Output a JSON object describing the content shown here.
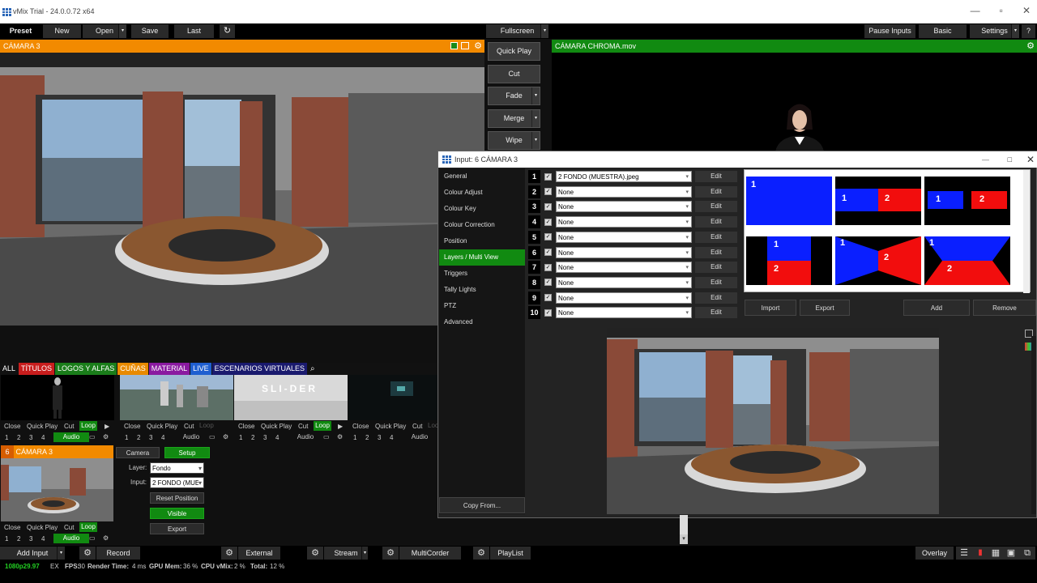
{
  "window": {
    "title": "vMix Trial - 24.0.0.72 x64",
    "controls": [
      "—",
      "▫",
      "✕"
    ]
  },
  "menu": {
    "preset": "Preset",
    "new": "New",
    "open": "Open",
    "save": "Save",
    "last": "Last",
    "fullscreen": "Fullscreen",
    "pause_inputs": "Pause Inputs",
    "basic": "Basic",
    "settings": "Settings",
    "help": "?"
  },
  "preview": {
    "title": "CÁMARA 3"
  },
  "output": {
    "title": "CÁMARA CHROMA.mov"
  },
  "transitions": {
    "quick_play": "Quick Play",
    "cut": "Cut",
    "fade": "Fade",
    "merge": "Merge",
    "wipe": "Wipe"
  },
  "tabs": [
    {
      "label": "ALL",
      "color": "#111111"
    },
    {
      "label": "TÍTULOS",
      "color": "#c81d1d"
    },
    {
      "label": "LOGOS Y ALFAS",
      "color": "#1a7d1a"
    },
    {
      "label": "CUÑAS",
      "color": "#e88a00"
    },
    {
      "label": "MATERIAL",
      "color": "#8a1aa0"
    },
    {
      "label": "LIVE",
      "color": "#1f5fd0"
    },
    {
      "label": "ESCENARIOS VIRTUALES",
      "color": "#1a1a6e"
    }
  ],
  "input_controls": {
    "close": "Close",
    "quick_play": "Quick Play",
    "cut": "Cut",
    "loop": "Loop",
    "audio": "Audio",
    "nums": [
      "1",
      "2",
      "3",
      "4"
    ],
    "loc": "Loc"
  },
  "slider_text": "SLI-DER",
  "input6": {
    "number": "6",
    "title": "CÁMARA 3",
    "camera": "Camera",
    "setup": "Setup",
    "layer_label": "Layer:",
    "layer_value": "Fondo",
    "input_label": "Input:",
    "input_value": "2 FONDO (MUE",
    "reset": "Reset Position",
    "visible": "Visible",
    "export": "Export"
  },
  "dialog": {
    "title": "Input: 6 CÁMARA 3",
    "nav": [
      "General",
      "Colour Adjust",
      "Colour Key",
      "Colour Correction",
      "Position",
      "Layers / Multi View",
      "Triggers",
      "Tally Lights",
      "PTZ",
      "Advanced"
    ],
    "copy_from": "Copy From...",
    "edit": "Edit",
    "layers": [
      {
        "n": "1",
        "value": "2 FONDO (MUESTRA).jpeg"
      },
      {
        "n": "2",
        "value": "None"
      },
      {
        "n": "3",
        "value": "None"
      },
      {
        "n": "4",
        "value": "None"
      },
      {
        "n": "5",
        "value": "None"
      },
      {
        "n": "6",
        "value": "None"
      },
      {
        "n": "7",
        "value": "None"
      },
      {
        "n": "8",
        "value": "None"
      },
      {
        "n": "9",
        "value": "None"
      },
      {
        "n": "10",
        "value": "None"
      }
    ],
    "layout_labels": {
      "one": "1",
      "two": "2"
    },
    "import": "Import",
    "export": "Export",
    "add": "Add",
    "remove": "Remove"
  },
  "bottom": {
    "add_input": "Add Input",
    "record": "Record",
    "external": "External",
    "stream": "Stream",
    "multicorder": "MultiCorder",
    "playlist": "PlayList",
    "overlay": "Overlay"
  },
  "status": {
    "format": "1080p29.97",
    "ex": "EX",
    "fps_label": "FPS:",
    "fps": "30",
    "render_label": "Render Time:",
    "render": "4 ms",
    "gpu_label": "GPU Mem:",
    "gpu": "36 %",
    "cpu_label": "CPU vMix:",
    "cpu": "2 %",
    "total_label": "Total:",
    "total": "12 %"
  }
}
